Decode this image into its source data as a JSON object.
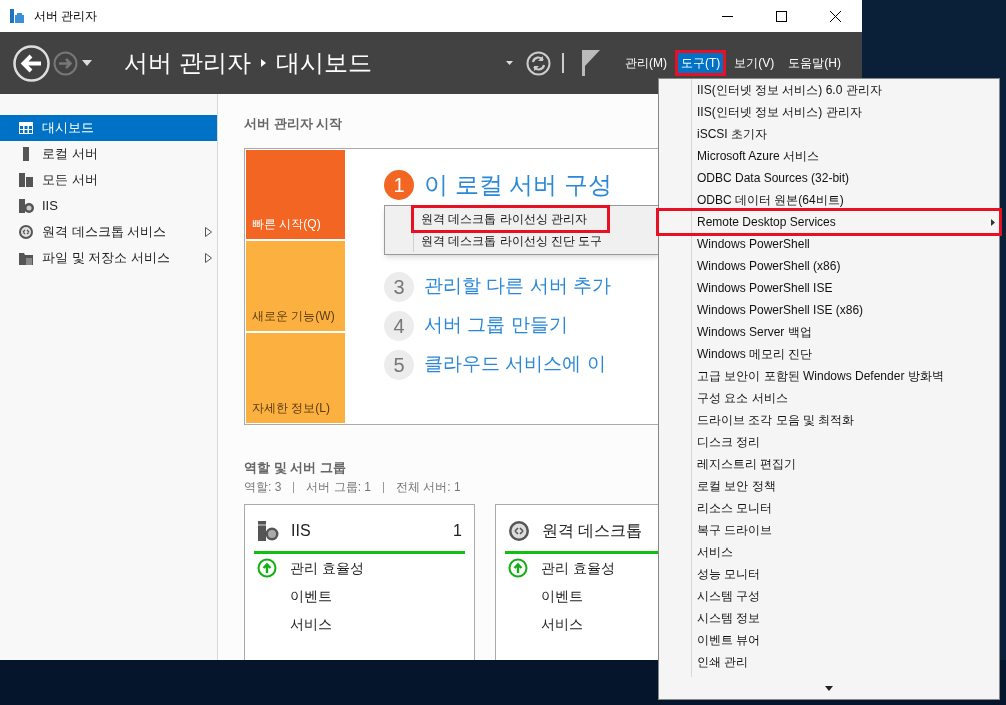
{
  "window": {
    "title": "서버 관리자"
  },
  "header": {
    "breadcrumb": [
      "서버 관리자",
      "대시보드"
    ],
    "menus": [
      {
        "label": "관리(M)",
        "selected": false,
        "outlined": false
      },
      {
        "label": "도구(T)",
        "selected": true,
        "outlined": true
      },
      {
        "label": "보기(V)",
        "selected": false,
        "outlined": false
      },
      {
        "label": "도움말(H)",
        "selected": false,
        "outlined": false
      }
    ]
  },
  "sidebar": {
    "items": [
      {
        "label": "대시보드",
        "selected": true,
        "expandable": false
      },
      {
        "label": "로컬 서버",
        "selected": false,
        "expandable": false
      },
      {
        "label": "모든 서버",
        "selected": false,
        "expandable": false
      },
      {
        "label": "IIS",
        "selected": false,
        "expandable": false
      },
      {
        "label": "원격 데스크톱 서비스",
        "selected": false,
        "expandable": true
      },
      {
        "label": "파일 및 저장소 서비스",
        "selected": false,
        "expandable": true
      }
    ]
  },
  "welcome": {
    "title": "서버 관리자 시작",
    "tiles": [
      {
        "label": "빠른 시작(Q)",
        "selected": true
      },
      {
        "label": "새로운 기능(W)",
        "selected": false
      },
      {
        "label": "자세한 정보(L)",
        "selected": false
      }
    ],
    "steps": [
      {
        "number": "1",
        "label": "이 로컬 서버 구성",
        "current": true
      },
      {
        "number": "3",
        "label": "관리할 다른 서버 추가",
        "current": false
      },
      {
        "number": "4",
        "label": "서버 그룹 만들기",
        "current": false
      },
      {
        "number": "5",
        "label": "클라우드 서비스에 이",
        "current": false
      }
    ]
  },
  "roles": {
    "title": "역할 및 서버 그룹",
    "summary": [
      "역할: 3",
      "서버 그룹: 1",
      "전체 서버: 1"
    ],
    "cards": [
      {
        "title": "IIS",
        "count": "1",
        "rows": [
          {
            "label": "관리 효율성",
            "ok": true
          },
          {
            "label": "이벤트",
            "ok": false
          },
          {
            "label": "서비스",
            "ok": false
          }
        ]
      },
      {
        "title": "원격 데스크톱",
        "rows": [
          {
            "label": "관리 효율성",
            "ok": true
          },
          {
            "label": "이벤트",
            "ok": false
          },
          {
            "label": "서비스",
            "ok": false
          }
        ]
      }
    ]
  },
  "submenu": {
    "items": [
      {
        "label": "원격 데스크톱 라이선싱 관리자",
        "outlined": true
      },
      {
        "label": "원격 데스크톱 라이선싱 진단 도구",
        "outlined": false
      }
    ]
  },
  "tools_menu": {
    "more_below": true,
    "items": [
      {
        "label": "IIS(인터넷 정보 서비스) 6.0 관리자",
        "submenu": false,
        "outlined": false
      },
      {
        "label": "IIS(인터넷 정보 서비스) 관리자",
        "submenu": false,
        "outlined": false
      },
      {
        "label": "iSCSI 초기자",
        "submenu": false,
        "outlined": false
      },
      {
        "label": "Microsoft Azure 서비스",
        "submenu": false,
        "outlined": false
      },
      {
        "label": "ODBC Data Sources (32-bit)",
        "submenu": false,
        "outlined": false
      },
      {
        "label": "ODBC 데이터 원본(64비트)",
        "submenu": false,
        "outlined": false
      },
      {
        "label": "Remote Desktop Services",
        "submenu": true,
        "outlined": true
      },
      {
        "label": "Windows PowerShell",
        "submenu": false,
        "outlined": false
      },
      {
        "label": "Windows PowerShell (x86)",
        "submenu": false,
        "outlined": false
      },
      {
        "label": "Windows PowerShell ISE",
        "submenu": false,
        "outlined": false
      },
      {
        "label": "Windows PowerShell ISE (x86)",
        "submenu": false,
        "outlined": false
      },
      {
        "label": "Windows Server 백업",
        "submenu": false,
        "outlined": false
      },
      {
        "label": "Windows 메모리 진단",
        "submenu": false,
        "outlined": false
      },
      {
        "label": "고급 보안이 포함된 Windows Defender 방화벽",
        "submenu": false,
        "outlined": false
      },
      {
        "label": "구성 요소 서비스",
        "submenu": false,
        "outlined": false
      },
      {
        "label": "드라이브 조각 모음 및 최적화",
        "submenu": false,
        "outlined": false
      },
      {
        "label": "디스크 정리",
        "submenu": false,
        "outlined": false
      },
      {
        "label": "레지스트리 편집기",
        "submenu": false,
        "outlined": false
      },
      {
        "label": "로컬 보안 정책",
        "submenu": false,
        "outlined": false
      },
      {
        "label": "리소스 모니터",
        "submenu": false,
        "outlined": false
      },
      {
        "label": "복구 드라이브",
        "submenu": false,
        "outlined": false
      },
      {
        "label": "서비스",
        "submenu": false,
        "outlined": false
      },
      {
        "label": "성능 모니터",
        "submenu": false,
        "outlined": false
      },
      {
        "label": "시스템 구성",
        "submenu": false,
        "outlined": false
      },
      {
        "label": "시스템 정보",
        "submenu": false,
        "outlined": false
      },
      {
        "label": "이벤트 뷰어",
        "submenu": false,
        "outlined": false
      },
      {
        "label": "인쇄 관리",
        "submenu": false,
        "outlined": false
      }
    ]
  }
}
